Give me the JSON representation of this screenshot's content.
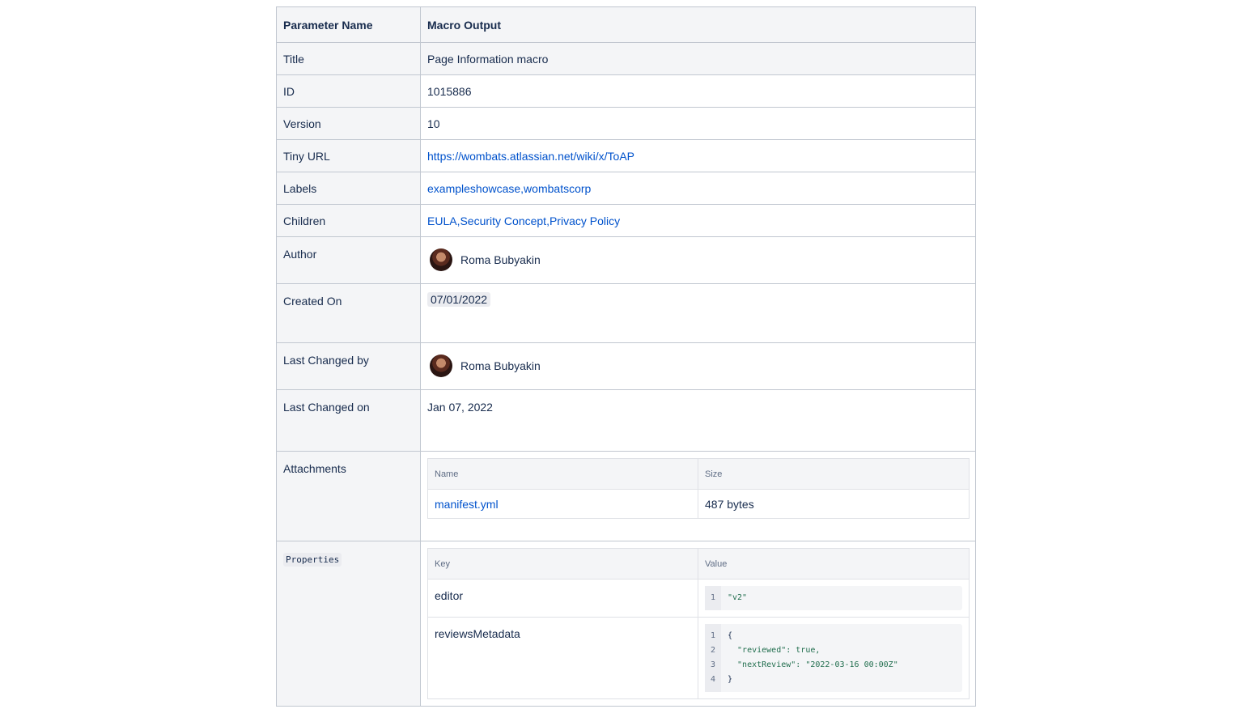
{
  "header": {
    "param_label": "Parameter Name",
    "output_label": "Macro Output"
  },
  "rows": {
    "title": {
      "label": "Title",
      "value": "Page Information macro"
    },
    "id": {
      "label": "ID",
      "value": "1015886"
    },
    "version": {
      "label": "Version",
      "value": "10"
    },
    "tiny_url": {
      "label": "Tiny URL",
      "value": "https://wombats.atlassian.net/wiki/x/ToAP"
    },
    "labels": {
      "label": "Labels",
      "value": "exampleshowcase,wombatscorp"
    },
    "children": {
      "label": "Children",
      "value": "EULA,Security Concept,Privacy Policy"
    },
    "author": {
      "label": "Author",
      "value": "Roma Bubyakin"
    },
    "created_on": {
      "label": "Created On",
      "value": "07/01/2022"
    },
    "last_changed_by": {
      "label": "Last Changed by",
      "value": "Roma Bubyakin"
    },
    "last_changed_on": {
      "label": "Last Changed on",
      "value": "Jan 07, 2022"
    },
    "attachments": {
      "label": "Attachments",
      "col_name": "Name",
      "col_size": "Size",
      "items": [
        {
          "name": "manifest.yml",
          "size": "487 bytes"
        }
      ]
    },
    "properties": {
      "label": "Properties",
      "col_key": "Key",
      "col_value": "Value",
      "items": [
        {
          "key": "editor",
          "line_numbers": [
            "1"
          ],
          "code": [
            "\"v2\""
          ]
        },
        {
          "key": "reviewsMetadata",
          "line_numbers": [
            "1",
            "2",
            "3",
            "4"
          ],
          "code": [
            "{",
            "  \"reviewed\": true,",
            "  \"nextReview\": \"2022-03-16 00:00Z\"",
            "}"
          ]
        }
      ]
    }
  },
  "colors": {
    "link": "#0052cc",
    "header_bg": "#f4f5f7",
    "border": "#c1c7d0",
    "code_string": "#216e4e"
  }
}
